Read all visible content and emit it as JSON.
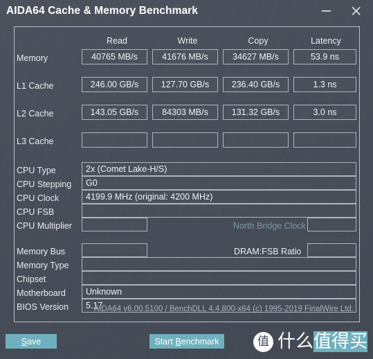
{
  "window": {
    "title": "AIDA64 Cache & Memory Benchmark",
    "minimize_icon": "minimize-icon",
    "close_icon": "close-icon",
    "accent_color": "#6fb0bd",
    "background_color": "#474d58"
  },
  "benchmark": {
    "columns": [
      "Read",
      "Write",
      "Copy",
      "Latency"
    ],
    "rows": [
      {
        "label": "Memory",
        "read": "40765 MB/s",
        "write": "41676 MB/s",
        "copy": "34627 MB/s",
        "latency": "53.9 ns"
      },
      {
        "label": "L1 Cache",
        "read": "246.00 GB/s",
        "write": "127.70 GB/s",
        "copy": "236.40 GB/s",
        "latency": "1.3 ns"
      },
      {
        "label": "L2 Cache",
        "read": "143.05 GB/s",
        "write": "84303 MB/s",
        "copy": "131.32 GB/s",
        "latency": "3.0 ns"
      },
      {
        "label": "L3 Cache",
        "read": "",
        "write": "",
        "copy": "",
        "latency": ""
      }
    ]
  },
  "cpu_info": {
    "type_label": "CPU Type",
    "type_value": "2x   (Comet Lake-H/S)",
    "stepping_label": "CPU Stepping",
    "stepping_value": "G0",
    "clock_label": "CPU Clock",
    "clock_value": "4199.9 MHz  (original: 4200 MHz)",
    "fsb_label": "CPU FSB",
    "fsb_value": "",
    "multiplier_label": "CPU Multiplier",
    "multiplier_value": "",
    "north_bridge_clock_label": "North Bridge Clock",
    "north_bridge_clock_value": ""
  },
  "system_info": {
    "memory_bus_label": "Memory Bus",
    "memory_bus_value": "",
    "dram_fsb_ratio_label": "DRAM:FSB Ratio",
    "dram_fsb_ratio_value": "",
    "memory_type_label": "Memory Type",
    "memory_type_value": "",
    "chipset_label": "Chipset",
    "chipset_value": "",
    "motherboard_label": "Motherboard",
    "motherboard_value": "Unknown",
    "bios_version_label": "BIOS Version",
    "bios_version_value": "5.17"
  },
  "footer": {
    "version_line": "AIDA64 v6.00.5100 / BenchDLL 4.4.800-x64  (c) 1995-2019 FinalWire Ltd.",
    "save_button": {
      "prefix": "",
      "accel": "S",
      "suffix": "ave"
    },
    "start_button": {
      "prefix": "Start ",
      "accel": "B",
      "suffix": "enchmark"
    }
  },
  "watermark": {
    "logo_char": "值",
    "text_plain": "什么",
    "text_highlight": "值得买"
  }
}
